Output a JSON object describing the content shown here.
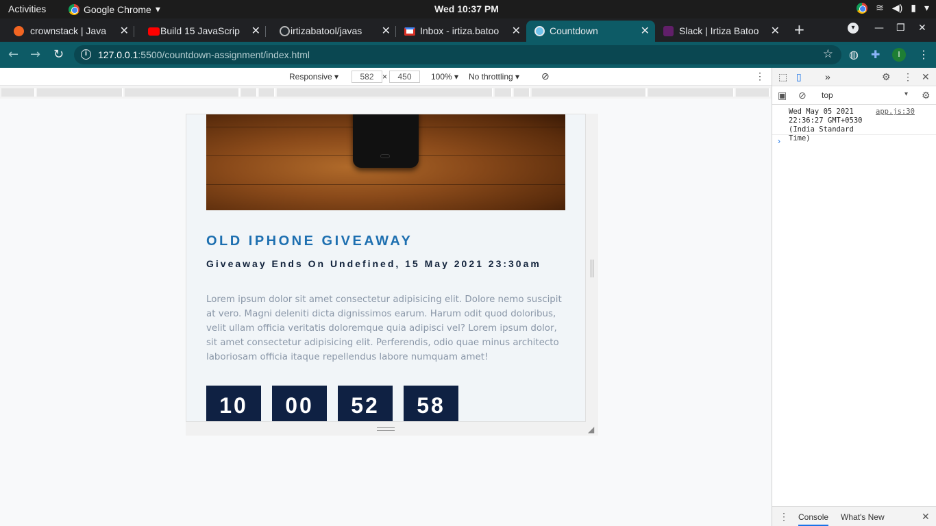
{
  "os": {
    "activities": "Activities",
    "app_name": "Google Chrome",
    "clock": "Wed 10:37 PM"
  },
  "tabs": [
    {
      "label": "crownstack | Java",
      "fav_color": "#f26522"
    },
    {
      "label": "Build 15 JavaScrip",
      "fav_color": "#ff0000"
    },
    {
      "label": "irtizabatool/javas",
      "fav_color": "#24292e"
    },
    {
      "label": "Inbox - irtiza.batoo",
      "fav_color": "#d93025"
    },
    {
      "label": "Countdown",
      "fav_color": "#6fc2ea",
      "active": true
    },
    {
      "label": "Slack | Irtiza Batoo",
      "fav_color": "#611f69"
    }
  ],
  "address": {
    "host": "127.0.0.1",
    "path": ":5500/countdown-assignment/index.html"
  },
  "device_toolbar": {
    "mode": "Responsive ▾",
    "width": "582",
    "times": "×",
    "height": "450",
    "zoom": "100% ▾",
    "throttle": "No throttling ▾"
  },
  "page": {
    "title": "OLD IPHONE GIVEAWAY",
    "subtitle": "Giveaway Ends On Undefined, 15 May 2021 23:30am",
    "paragraph": "Lorem ipsum dolor sit amet consectetur adipisicing elit. Dolore nemo suscipit at vero. Magni deleniti dicta dignissimos earum. Harum odit quod doloribus, velit ullam officia veritatis doloremque quia adipisci vel? Lorem ipsum dolor, sit amet consectetur adipisicing elit. Perferendis, odio quae minus architecto laboriosam officia itaque repellendus labore numquam amet!",
    "countdown": [
      "10",
      "00",
      "52",
      "58"
    ]
  },
  "devtools": {
    "context": "top",
    "log_message": "Wed May 05 2021 22:36:27 GMT+0530 (India Standard Time)",
    "log_source": "app.js:30",
    "prompt": "›",
    "drawer_tabs": [
      "Console",
      "What's New"
    ]
  }
}
